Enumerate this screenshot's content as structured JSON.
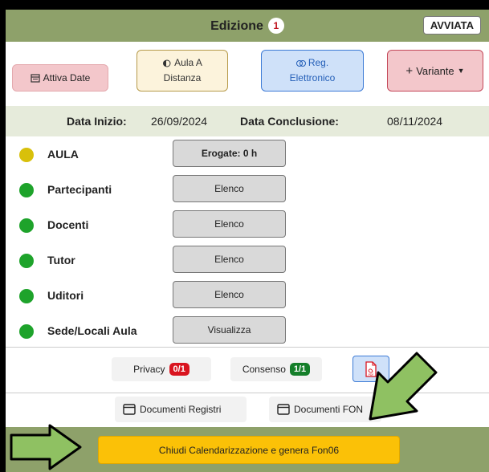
{
  "header": {
    "title": "Edizione",
    "count": "1",
    "status": "AVVIATA"
  },
  "actions": {
    "attiva_date": "Attiva Date",
    "aula_a_distanza_line1": "Aula A",
    "aula_a_distanza_line2": "Distanza",
    "reg_elettronico_line1": "Reg.",
    "reg_elettronico_line2": "Elettronico",
    "variante": "Variante"
  },
  "dates": {
    "start_label": "Data Inizio:",
    "start_value": "26/09/2024",
    "end_label": "Data Conclusione:",
    "end_value": "08/11/2024"
  },
  "rows": [
    {
      "label": "AULA",
      "button": "Erogate: 0 h",
      "status_color": "#d8c00b",
      "bold": true
    },
    {
      "label": "Partecipanti",
      "button": "Elenco",
      "status_color": "#1ea32b",
      "bold": false
    },
    {
      "label": "Docenti",
      "button": "Elenco",
      "status_color": "#1ea32b",
      "bold": false
    },
    {
      "label": "Tutor",
      "button": "Elenco",
      "status_color": "#1ea32b",
      "bold": false
    },
    {
      "label": "Uditori",
      "button": "Elenco",
      "status_color": "#1ea32b",
      "bold": false
    },
    {
      "label": "Sede/Locali Aula",
      "button": "Visualizza",
      "status_color": "#1ea32b",
      "bold": false
    }
  ],
  "consent": {
    "privacy_label": "Privacy",
    "privacy_count": "0/1",
    "privacy_color": "#d9141f",
    "consenso_label": "Consenso",
    "consenso_count": "1/1",
    "consenso_color": "#157f2a",
    "pdf_icon_text": "PDF"
  },
  "docs": {
    "registri": "Documenti Registri",
    "fon": "Documenti FON"
  },
  "footer": {
    "close_button": "Chiudi Calendarizzazione e genera Fon06"
  },
  "colors": {
    "header_bg": "#8ea16a",
    "arrow": "#8fc162"
  }
}
